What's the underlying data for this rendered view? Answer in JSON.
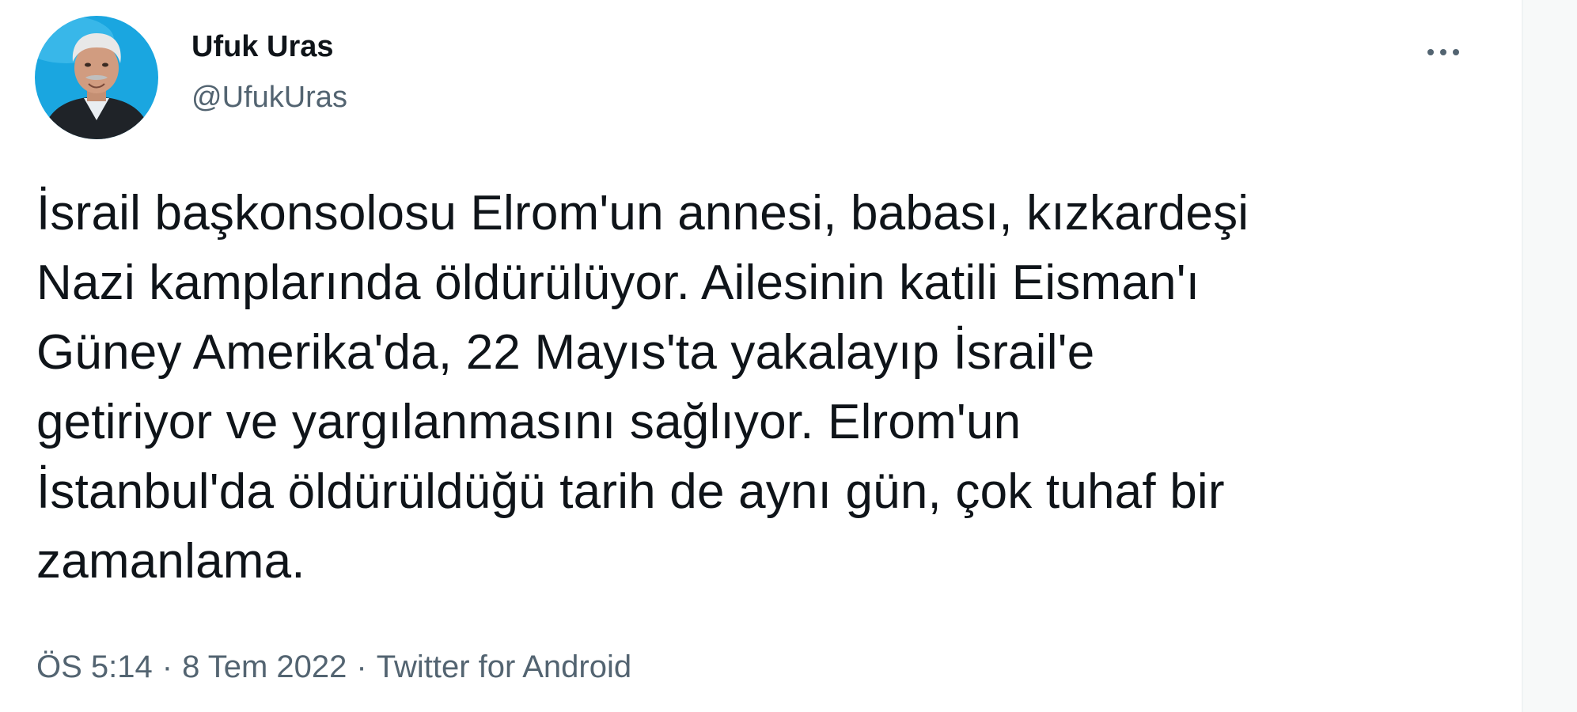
{
  "author": {
    "display_name": "Ufuk Uras",
    "handle": "@UfukUras",
    "avatar_icon": "profile-photo"
  },
  "actions": {
    "more_icon": "more-horizontal-icon"
  },
  "tweet": {
    "lines": [
      "İsrail başkonsolosu Elrom'un annesi, babası, kızkardeşi",
      "Nazi kamplarında öldürülüyor. Ailesinin katili Eisman'ı",
      "Güney Amerika'da, 22 Mayıs'ta yakalayıp İsrail'e",
      "getiriyor ve yargılanmasını sağlıyor. Elrom'un",
      "İstanbul'da öldürüldüğü tarih de aynı gün, çok tuhaf bir",
      "zamanlama."
    ]
  },
  "meta": {
    "time": "ÖS 5:14",
    "separator": "·",
    "date": "8 Tem 2022",
    "source": "Twitter for Android"
  },
  "colors": {
    "text_primary": "#0f1419",
    "text_secondary": "#536471",
    "avatar_bg": "#1da1f2"
  }
}
